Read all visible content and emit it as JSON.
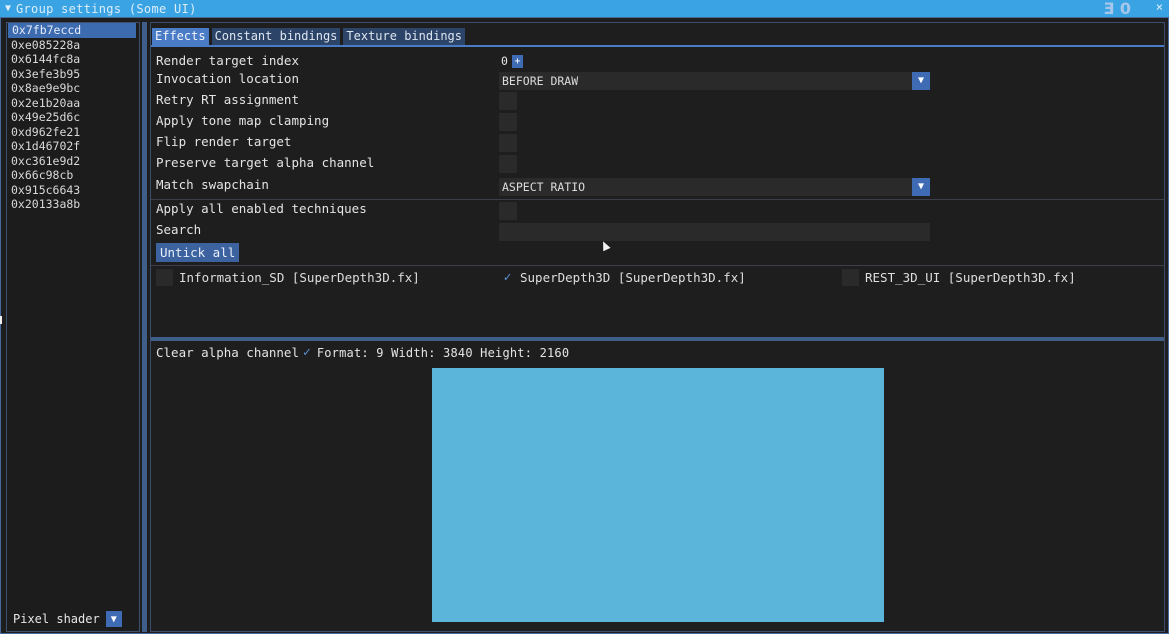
{
  "window": {
    "title": "Group settings (Some UI)",
    "close_glyph": "×",
    "collapse_glyph": "▼",
    "logo_text": "Ǝ 0"
  },
  "sidebar": {
    "items": [
      "0x7fb7eccd",
      "0xe085228a",
      "0x6144fc8a",
      "0x3efe3b95",
      "0x8ae9e9bc",
      "0x2e1b20aa",
      "0x49e25d6c",
      "0xd962fe21",
      "0x1d46702f",
      "0xc361e9d2",
      "0x66c98cb",
      "0x915c6643",
      "0x20133a8b"
    ],
    "selected_index": 0,
    "shader_label": "Pixel shader",
    "shader_arrow": "▼"
  },
  "tabs": [
    "Effects",
    "Constant bindings",
    "Texture bindings"
  ],
  "active_tab": 0,
  "effects": {
    "render_target_index_label": "Render target index",
    "render_target_index_value": "0",
    "plus_glyph": "+",
    "invocation_location_label": "Invocation location",
    "invocation_location_value": "BEFORE DRAW",
    "retry_rt_label": "Retry RT assignment",
    "tonemap_label": "Apply tone map clamping",
    "flip_label": "Flip render target",
    "preserve_alpha_label": "Preserve target alpha channel",
    "match_swapchain_label": "Match swapchain",
    "match_swapchain_value": "ASPECT RATIO",
    "combo_arrow": "▼",
    "apply_all_label": "Apply all enabled techniques",
    "search_label": "Search",
    "search_value": "",
    "untick_all_label": "Untick all"
  },
  "techniques": [
    {
      "name": "Information_SD [SuperDepth3D.fx]",
      "checked": false
    },
    {
      "name": "SuperDepth3D [SuperDepth3D.fx]",
      "checked": true
    },
    {
      "name": "REST_3D_UI [SuperDepth3D.fx]",
      "checked": false
    }
  ],
  "check_glyph": "✓",
  "preview": {
    "clear_alpha_label": "Clear alpha channel",
    "info": "Format: 9 Width: 3840 Height: 2160",
    "color": "#5bb4d9"
  },
  "colors": {
    "titlebar": "#3aa3e4",
    "accent": "#4a7bc6",
    "button": "#3e6bb4"
  }
}
